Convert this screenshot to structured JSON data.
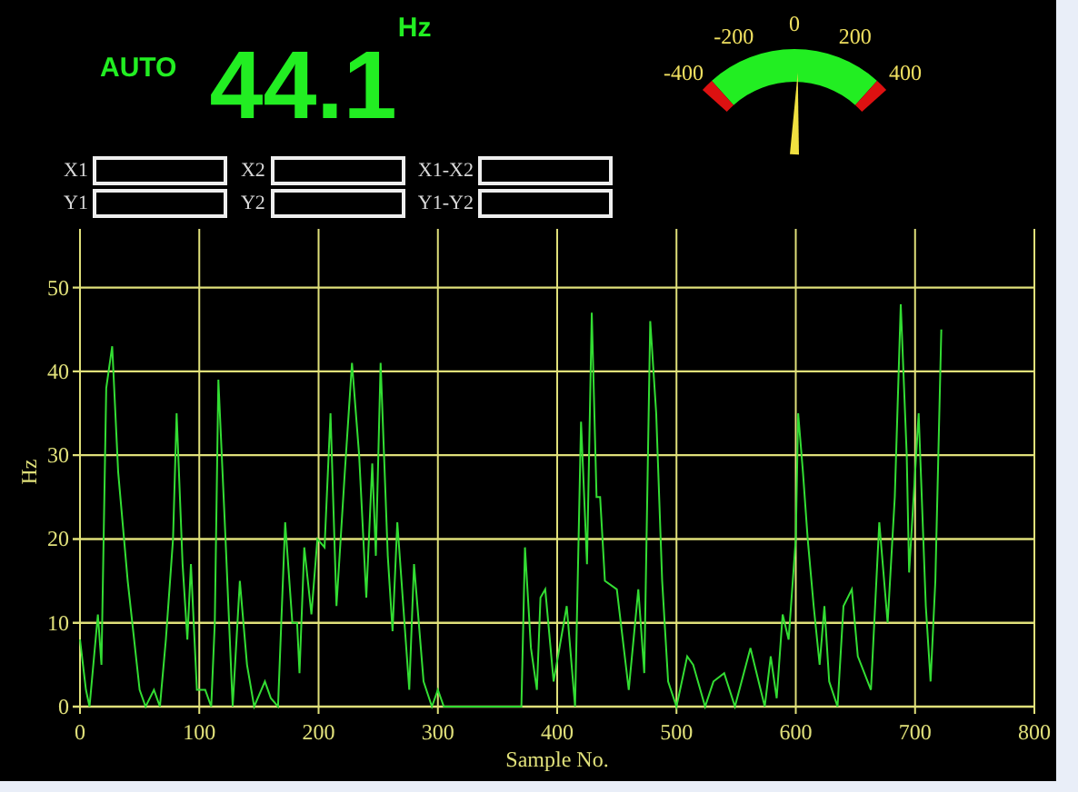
{
  "header": {
    "mode": "AUTO",
    "reading": "44.1",
    "unit": "Hz"
  },
  "gauge": {
    "labels": [
      "-400",
      "-200",
      "0",
      "200",
      "400"
    ],
    "level": 0.52
  },
  "cursor_groups": [
    {
      "labels": [
        "X1",
        "Y1"
      ]
    },
    {
      "labels": [
        "X2",
        "Y2"
      ]
    },
    {
      "labels": [
        "X1-X2",
        "Y1-Y2"
      ]
    }
  ],
  "chart_data": {
    "type": "line",
    "grid": true,
    "xlabel": "Sample No.",
    "ylabel": "Hz",
    "xlim": [
      0,
      800
    ],
    "ylim": [
      0,
      57
    ],
    "xticks": [
      0,
      100,
      200,
      300,
      400,
      500,
      600,
      700,
      800
    ],
    "yticks": [
      0,
      10,
      20,
      30,
      40,
      50
    ],
    "x": [
      0,
      5,
      8,
      15,
      18,
      22,
      27,
      32,
      40,
      50,
      55,
      62,
      67,
      72,
      78,
      81,
      86,
      90,
      93,
      98,
      105,
      110,
      113,
      116,
      122,
      128,
      134,
      140,
      146,
      155,
      160,
      166,
      172,
      178,
      182,
      184,
      188,
      194,
      199,
      205,
      210,
      215,
      222,
      228,
      234,
      240,
      245,
      248,
      252,
      258,
      262,
      266,
      272,
      276,
      280,
      288,
      295,
      300,
      305,
      370,
      373,
      378,
      383,
      386,
      390,
      397,
      408,
      415,
      420,
      425,
      429,
      433,
      436,
      440,
      450,
      460,
      468,
      473,
      478,
      483,
      488,
      493,
      500,
      509,
      514,
      524,
      531,
      540,
      549,
      562,
      574,
      579,
      584,
      589,
      594,
      600,
      602,
      606,
      610,
      615,
      620,
      624,
      628,
      635,
      640,
      647,
      652,
      663,
      670,
      677,
      683,
      688,
      693,
      695,
      703,
      709,
      713,
      717,
      722
    ],
    "series": [
      {
        "color": "#33dd33",
        "values": [
          8,
          2,
          0,
          11,
          5,
          38,
          43,
          28,
          15,
          2,
          0,
          2,
          0,
          8,
          20,
          35,
          17,
          8,
          17,
          2,
          2,
          0,
          10,
          39,
          20,
          0,
          15,
          5,
          0,
          3,
          1,
          0,
          22,
          10,
          10,
          4,
          19,
          11,
          20,
          19,
          35,
          12,
          28,
          41,
          30,
          13,
          29,
          18,
          41,
          18,
          9,
          22,
          10,
          2,
          17,
          3,
          0,
          2,
          0,
          0,
          19,
          7,
          2,
          13,
          14,
          3,
          12,
          0,
          34,
          17,
          47,
          25,
          25,
          15,
          14,
          2,
          14,
          4,
          46,
          35,
          15,
          3,
          0,
          6,
          5,
          0,
          3,
          4,
          0,
          7,
          0,
          6,
          1,
          11,
          8,
          20,
          35,
          28,
          20,
          12,
          5,
          12,
          3,
          0,
          12,
          14,
          6,
          2,
          22,
          10,
          25,
          48,
          30,
          16,
          35,
          12,
          3,
          15,
          45
        ]
      }
    ]
  }
}
